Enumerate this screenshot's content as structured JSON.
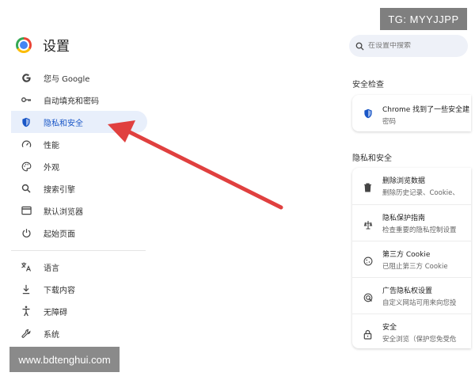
{
  "header": {
    "title": "设置"
  },
  "search": {
    "placeholder": "在设置中搜索"
  },
  "sidebar": {
    "items": [
      {
        "label": "您与 Google",
        "icon": "google-icon"
      },
      {
        "label": "自动填充和密码",
        "icon": "key-icon"
      },
      {
        "label": "隐私和安全",
        "icon": "shield-icon",
        "active": true
      },
      {
        "label": "性能",
        "icon": "speedometer-icon"
      },
      {
        "label": "外观",
        "icon": "palette-icon"
      },
      {
        "label": "搜索引擎",
        "icon": "search-icon"
      },
      {
        "label": "默认浏览器",
        "icon": "browser-window-icon"
      },
      {
        "label": "起始页面",
        "icon": "power-icon"
      }
    ],
    "items2": [
      {
        "label": "语言",
        "icon": "translate-icon"
      },
      {
        "label": "下载内容",
        "icon": "download-icon"
      },
      {
        "label": "无障碍",
        "icon": "accessibility-icon"
      },
      {
        "label": "系统",
        "icon": "wrench-icon"
      }
    ]
  },
  "safety_check": {
    "label": "安全检查",
    "title": "Chrome 找到了一些安全建",
    "sub": "密码"
  },
  "privacy": {
    "label": "隐私和安全",
    "rows": [
      {
        "title": "删除浏览数据",
        "sub": "删除历史记录、Cookie、",
        "icon": "trash-icon"
      },
      {
        "title": "隐私保护指南",
        "sub": "检查重要的隐私控制设置",
        "icon": "privacy-guide-icon"
      },
      {
        "title": "第三方 Cookie",
        "sub": "已阻止第三方 Cookie",
        "icon": "cookie-icon"
      },
      {
        "title": "广告隐私权设置",
        "sub": "自定义网站可用来向您投",
        "icon": "ad-privacy-icon"
      },
      {
        "title": "安全",
        "sub": "安全浏览（保护您免受危",
        "icon": "lock-icon"
      }
    ]
  },
  "overlays": {
    "tg": "TG: MYYJJPP",
    "watermark": "www.bdtenghui.com"
  },
  "colors": {
    "accent": "#1a57c7",
    "active_bg": "#e8effb",
    "arrow": "#e0403f"
  }
}
